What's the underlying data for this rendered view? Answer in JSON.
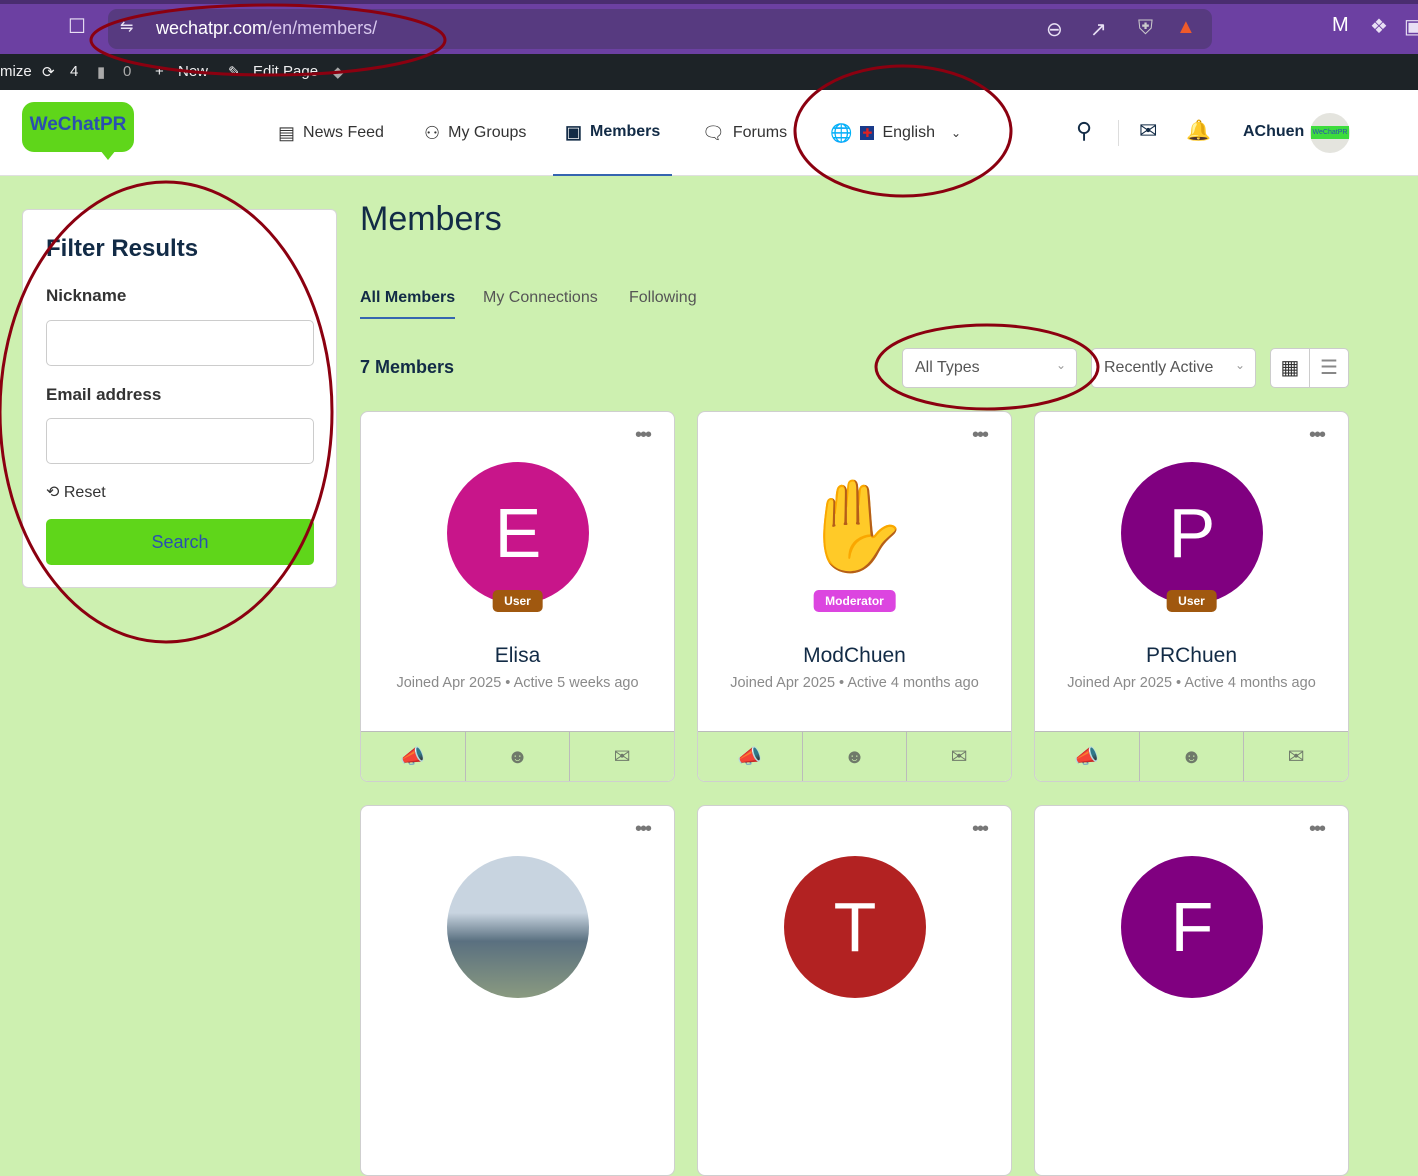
{
  "browser": {
    "url_domain": "wechatpr.com",
    "url_path": "/en/members/"
  },
  "admin_bar": {
    "customize": "mize",
    "updates": "4",
    "comments": "0",
    "new": "New",
    "edit_page": "Edit Page"
  },
  "header": {
    "logo": "WeChatPR",
    "nav": [
      {
        "label": "News Feed",
        "icon": "newspaper-icon"
      },
      {
        "label": "My Groups",
        "icon": "groups-icon"
      },
      {
        "label": "Members",
        "icon": "member-icon"
      },
      {
        "label": "Forums",
        "icon": "chat-icon"
      }
    ],
    "language": "English",
    "username": "AChuen"
  },
  "sidebar": {
    "title": "Filter Results",
    "nickname_label": "Nickname",
    "nickname_value": "",
    "email_label": "Email address",
    "email_value": "",
    "reset": "Reset",
    "search": "Search"
  },
  "main": {
    "title": "Members",
    "tabs": [
      "All Members",
      "My Connections",
      "Following"
    ],
    "count": "7 Members",
    "type_filter": "All Types",
    "sort": "Recently Active"
  },
  "members": [
    {
      "initial": "E",
      "name": "Elisa",
      "role": "User",
      "joined": "Joined Apr 2025",
      "active": "Active 5 weeks ago",
      "color": "#c8158a",
      "role_color": "#a0580f"
    },
    {
      "initial": "",
      "name": "ModChuen",
      "role": "Moderator",
      "joined": "Joined Apr 2025",
      "active": "Active 4 months ago",
      "color": "#ffffff",
      "role_color": "#dc45e0"
    },
    {
      "initial": "P",
      "name": "PRChuen",
      "role": "User",
      "joined": "Joined Apr 2025",
      "active": "Active 4 months ago",
      "color": "#800080",
      "role_color": "#a0580f"
    },
    {
      "initial": "",
      "color": "#9fb3c8"
    },
    {
      "initial": "T",
      "color": "#b22222"
    },
    {
      "initial": "F",
      "color": "#800080"
    }
  ]
}
